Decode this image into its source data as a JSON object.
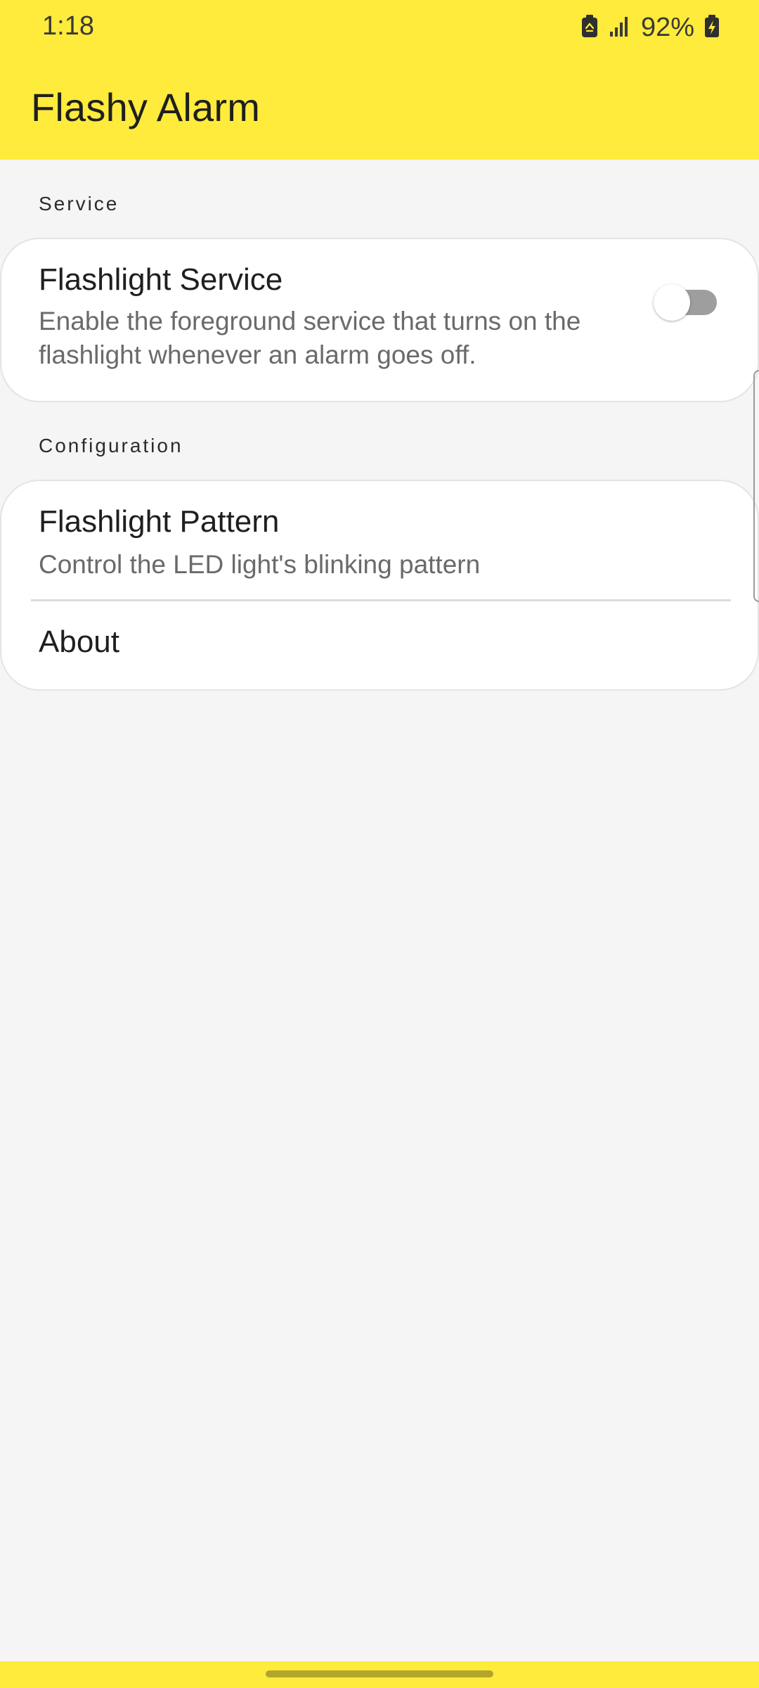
{
  "status_bar": {
    "time": "1:18",
    "battery_percent": "92%",
    "icons": [
      "battery-saver-icon",
      "signal-icon",
      "battery-charging-icon"
    ]
  },
  "app_bar": {
    "title": "Flashy Alarm",
    "background_color": "#ffeb3b"
  },
  "sections": {
    "service": {
      "header": "Service",
      "items": [
        {
          "title": "Flashlight Service",
          "summary": "Enable the foreground service that turns on the flashlight whenever an alarm goes off.",
          "toggle_on": false
        }
      ]
    },
    "configuration": {
      "header": "Configuration",
      "items": [
        {
          "title": "Flashlight Pattern",
          "summary": "Control the LED light's blinking pattern"
        },
        {
          "title": "About"
        }
      ]
    }
  }
}
